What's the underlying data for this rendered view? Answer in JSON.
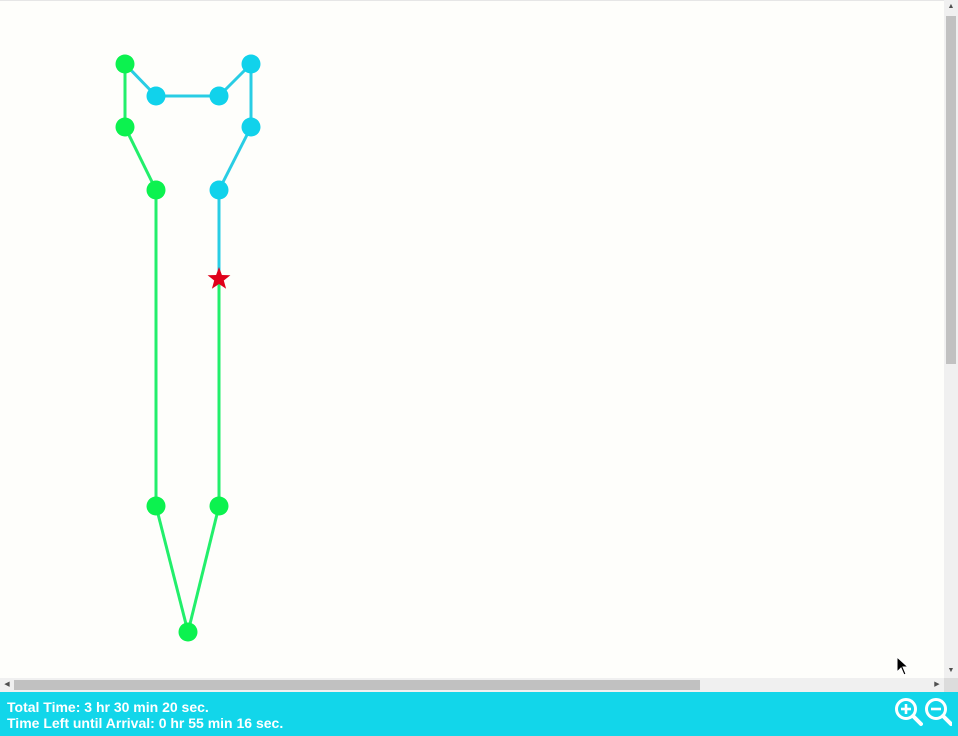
{
  "footer": {
    "total_time": "Total Time: 3 hr 30 min 20 sec.",
    "time_left": "Time Left until Arrival: 0 hr 55 min 16 sec."
  },
  "controls": {
    "zoom_in_icon": "zoom-in-icon",
    "zoom_out_icon": "zoom-out-icon"
  },
  "colors": {
    "background": "#fefefb",
    "footer": "#12d6ea",
    "traveled_segment": "#22ef6b",
    "traveled_node": "#0cf24f",
    "remaining_segment": "#29cde4",
    "remaining_node": "#11d2eb",
    "current_position": "#e0001a"
  },
  "route": {
    "progress_fraction": 0.737,
    "current_position_marker": "star"
  }
}
